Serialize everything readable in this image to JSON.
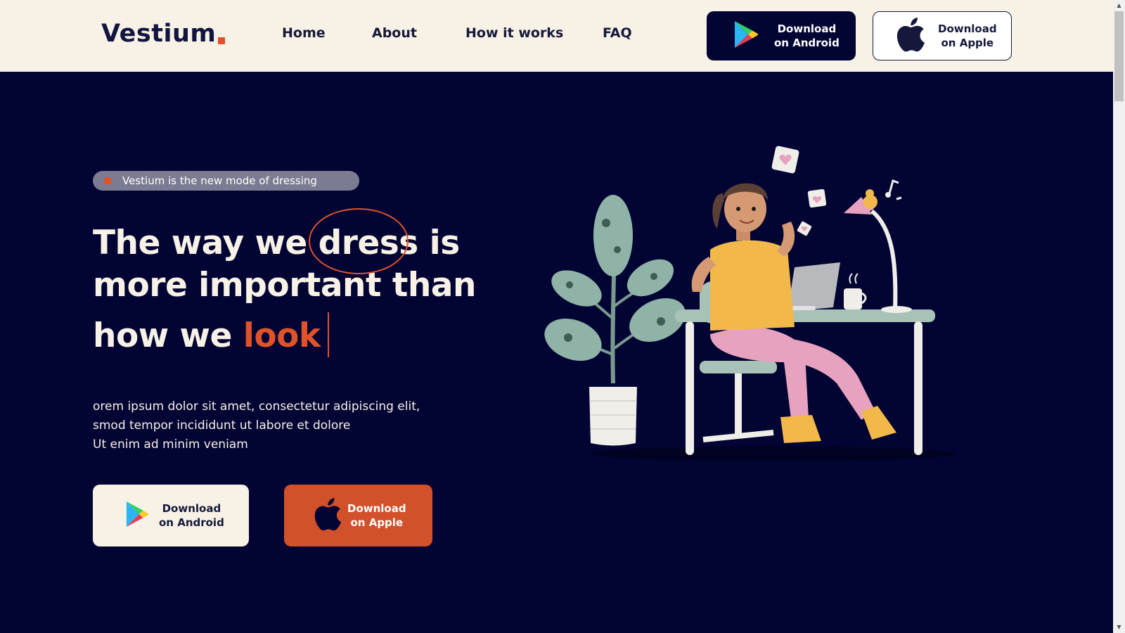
{
  "header": {
    "logo": "Vestium",
    "nav": [
      "Home",
      "About",
      "How it works",
      "FAQ"
    ],
    "android_button": {
      "line1": "Download",
      "line2": "on Android"
    },
    "apple_button": {
      "line1": "Download",
      "line2": "on Apple"
    }
  },
  "hero": {
    "badge": "Vestium is the new mode of dressing",
    "headline": {
      "part1": "The way we ",
      "highlight": "dress",
      "part2": " is",
      "line2": "more important than",
      "line3_prefix": "how we ",
      "accent": "look"
    },
    "description": [
      "orem ipsum dolor sit amet, consectetur adipiscing elit,",
      "smod tempor incididunt ut labore et dolore",
      "Ut enim ad minim veniam"
    ],
    "android_button": {
      "line1": "Download",
      "line2": "on Android"
    },
    "apple_button": {
      "line1": "Download",
      "line2": "on Apple"
    }
  },
  "colors": {
    "navy": "#020433",
    "cream": "#f8f1e6",
    "accent": "#e0532a",
    "badge_bg": "#7b7b92"
  },
  "icons": [
    "google-play-icon",
    "apple-icon"
  ]
}
